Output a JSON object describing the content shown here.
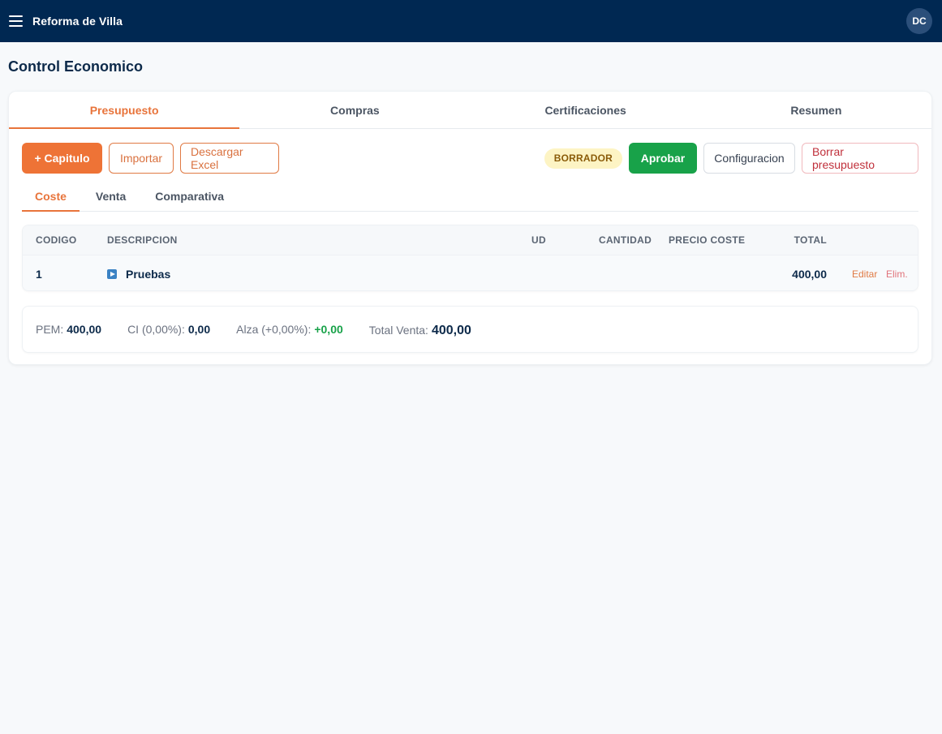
{
  "header": {
    "menu_icon": "hamburger-icon",
    "app_title": "Reforma de Villa",
    "avatar_initials": "DC"
  },
  "page": {
    "title": "Control Economico"
  },
  "main_tabs": [
    {
      "label": "Presupuesto",
      "active": true
    },
    {
      "label": "Compras",
      "active": false
    },
    {
      "label": "Certificaciones",
      "active": false
    },
    {
      "label": "Resumen",
      "active": false
    }
  ],
  "toolbar": {
    "add_chapter": "+ Capitulo",
    "import": "Importar",
    "download_excel": "Descargar Excel",
    "status_badge": "BORRADOR",
    "approve": "Aprobar",
    "config": "Configuracion",
    "delete_budget": "Borrar presupuesto"
  },
  "sub_tabs": [
    {
      "label": "Coste",
      "active": true
    },
    {
      "label": "Venta",
      "active": false
    },
    {
      "label": "Comparativa",
      "active": false
    }
  ],
  "table": {
    "headers": {
      "code": "CODIGO",
      "description": "DESCRIPCION",
      "unit": "UD",
      "quantity": "CANTIDAD",
      "cost_price": "PRECIO COSTE",
      "total": "TOTAL"
    },
    "rows": [
      {
        "code": "1",
        "description": "Pruebas",
        "total": "400,00",
        "edit": "Editar",
        "delete": "Elim."
      }
    ]
  },
  "summary": {
    "pem_label": "PEM:",
    "pem_value": "400,00",
    "ci_label": "CI (0,00%):",
    "ci_value": "0,00",
    "alza_label": "Alza (+0,00%):",
    "alza_value": "+0,00",
    "total_label": "Total Venta:",
    "total_value": "400,00"
  },
  "colors": {
    "header_bg": "#002852",
    "accent": "#ee7336",
    "approve": "#18a249",
    "danger": "#c0303b"
  }
}
